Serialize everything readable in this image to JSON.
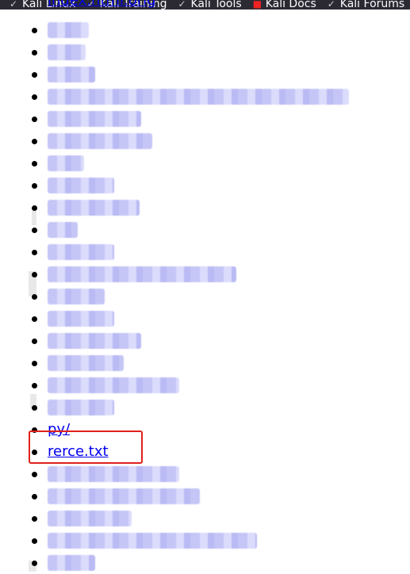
{
  "bookmarks": [
    {
      "label": "Kali Linux",
      "icon": "kali-dragon-icon"
    },
    {
      "label": "Kali Training",
      "icon": "kali-dragon-icon"
    },
    {
      "label": "Kali Tools",
      "icon": "kali-dragon-icon"
    },
    {
      "label": "Kali Docs",
      "icon": "kali-docs-icon"
    },
    {
      "label": "Kali Forums",
      "icon": "kali-dragon-icon"
    }
  ],
  "listing": {
    "partial_top_link": "index.html.orig",
    "items": [
      {
        "type": "redacted",
        "width": 52
      },
      {
        "type": "redacted",
        "width": 48
      },
      {
        "type": "redacted",
        "width": 60
      },
      {
        "type": "redacted",
        "width": 380
      },
      {
        "type": "redacted",
        "width": 118
      },
      {
        "type": "redacted",
        "width": 132
      },
      {
        "type": "redacted",
        "width": 46
      },
      {
        "type": "redacted",
        "width": 84
      },
      {
        "type": "redacted",
        "width": 116
      },
      {
        "type": "redacted",
        "width": 38
      },
      {
        "type": "redacted",
        "width": 84
      },
      {
        "type": "redacted",
        "width": 238
      },
      {
        "type": "redacted",
        "width": 72
      },
      {
        "type": "redacted",
        "width": 84
      },
      {
        "type": "redacted",
        "width": 118
      },
      {
        "type": "redacted",
        "width": 96
      },
      {
        "type": "redacted",
        "width": 166
      },
      {
        "type": "redacted",
        "width": 84
      },
      {
        "type": "link",
        "label": "py/"
      },
      {
        "type": "link",
        "label": "rerce.txt",
        "highlighted": true
      },
      {
        "type": "redacted",
        "width": 166
      },
      {
        "type": "redacted",
        "width": 192
      },
      {
        "type": "redacted",
        "width": 106
      },
      {
        "type": "redacted",
        "width": 264
      },
      {
        "type": "redacted",
        "width": 60
      }
    ]
  },
  "colors": {
    "link": "#0000ee",
    "highlight_border": "#e0201b",
    "bookmarks_bar_bg": "#2b2a33"
  }
}
